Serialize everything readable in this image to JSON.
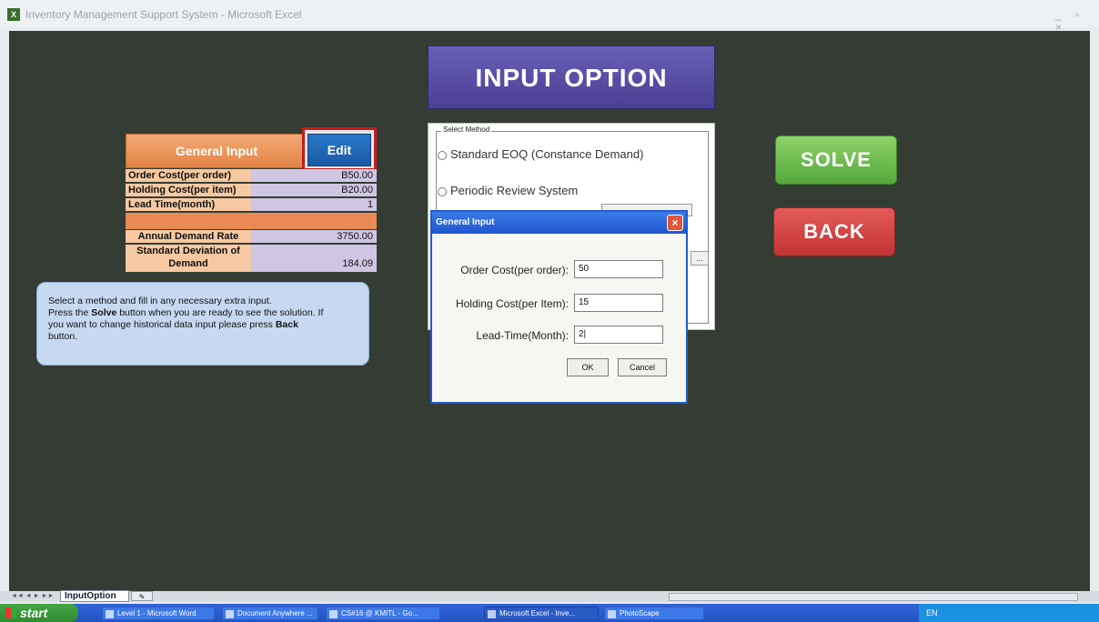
{
  "window": {
    "title": "Inventory Management Support System - Microsoft Excel",
    "app_icon": "excel-icon",
    "controls": "_ ▫ ×"
  },
  "banner": {
    "title": "INPUT OPTION"
  },
  "general_input": {
    "header": "General Input",
    "edit_label": "Edit",
    "rows": [
      {
        "label": "Order Cost(per order)",
        "value": "B50.00"
      },
      {
        "label": "Holding Cost(per item)",
        "value": "B20.00"
      },
      {
        "label": "Lead Time(month)",
        "value": "1"
      },
      {
        "label": "Annual Demand Rate",
        "value": "3750.00"
      },
      {
        "label": "Standard Deviation of",
        "label2": "Demand",
        "value": "184.09"
      }
    ]
  },
  "info": {
    "line1": "Select a method and fill in any necessary extra input.",
    "line2a": "Press the ",
    "line2b": "Solve",
    "line2c": " button when you are ready to see the solution. If",
    "line3": "you want to change historical data input please press ",
    "line3b": "Back",
    "line4": "button."
  },
  "method": {
    "legend": "Select Method",
    "options": [
      "Standard EOQ (Constance Demand)",
      "Periodic Review System"
    ],
    "hidden_button_1": "...",
    "hidden_button_2": "..."
  },
  "dialog": {
    "title": "General Input",
    "close": "×",
    "fields": [
      {
        "label": "Order Cost(per order):",
        "value": "50"
      },
      {
        "label": "Holding Cost(per Item):",
        "value": "15"
      },
      {
        "label": "Lead-Time(Month):",
        "value": "2|"
      }
    ],
    "ok_label": "OK",
    "cancel_label": "Cancel"
  },
  "actions": {
    "solve_label": "SOLVE",
    "back_label": "BACK"
  },
  "sheet_tabs": {
    "nav": "◄◄ ◄ ► ►►",
    "active": "InputOption",
    "new_tab": "✎"
  },
  "taskbar": {
    "start": "start",
    "items": [
      "Level 1 - Microsoft Word",
      "Document Anywhere ...",
      "CS#16 @ KMITL - Go...",
      "Microsoft Excel - Inve...",
      "PhotoScape"
    ],
    "tray": "EN"
  }
}
